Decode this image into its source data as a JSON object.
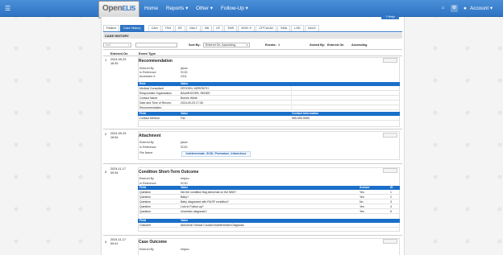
{
  "nav": {
    "menu_icon": "menu-icon",
    "logo_main": "Open",
    "logo_alt": "ELIS",
    "logo_sub": "Open Enterprise Laboratory Information System",
    "items": [
      "Home",
      "Reports ▾",
      "Other ▾",
      "Follow-Up ▾"
    ],
    "account": "Account ▾",
    "colors": {
      "bar": "#2f74c4",
      "accent": "#1a6fc9"
    }
  },
  "help_label": "? Help",
  "tabs": [
    "Patient",
    "Case History",
    "CAH",
    "TSH",
    "BT",
    "GALT",
    "HB",
    "CF",
    "TMS",
    "SCID ✔",
    "CPT1A AV",
    "SMA",
    "LSD",
    "XALD"
  ],
  "section_title": "CASE HISTORY",
  "controls": {
    "add_placeholder": "Add",
    "sort_by_label": "Sort By:",
    "sort_by_value": "Entered On, Ascending",
    "events_label": "Events:",
    "events_value": "4",
    "sorted_by_label": "Sorted By:",
    "sorted_by_field": "Entered On",
    "sorted_by_dir": "Ascending"
  },
  "columns": [
    "Entered On",
    "Event Type"
  ],
  "events": [
    {
      "num": "1",
      "date": "2024-09-23",
      "time": "16:39",
      "title": "Recommendation",
      "fields": [
        [
          "Entered By",
          "jlauer"
        ],
        [
          "In Reference",
          "SCID"
        ],
        [
          "Accession #",
          "2311"
        ]
      ],
      "role_header": [
        "Role",
        "Value"
      ],
      "roles": [
        [
          "Medical Consultant",
          "DRYDEN, MEREDITH"
        ],
        [
          "Responsible Organization",
          "BAUMHOVER, RENEE"
        ],
        [
          "Contact Name",
          "Bonnie White"
        ],
        [
          "Date and Time of Recom.",
          "2024-09-23 17:45"
        ],
        [
          "Recommendation",
          ""
        ]
      ],
      "contact_header": [
        "Field",
        "Value",
        "Contact Information"
      ],
      "contact": [
        "Contact Method",
        "Fax",
        "555-555-5555"
      ]
    },
    {
      "num": "2",
      "date": "2024-09-23",
      "time": "16:54",
      "title": "Attachment",
      "fields": [
        [
          "Entered By",
          "jlauer"
        ],
        [
          "In Reference",
          "SCID"
        ],
        [
          "File Name",
          ""
        ]
      ],
      "file": "Indeterminate_SCID_Premature_Infant.docx"
    },
    {
      "num": "3",
      "date": "2024-11-17",
      "time": "09:34",
      "title": "Condition Short-Term Outcome",
      "fields": [
        [
          "Entered By",
          "hirlyeu"
        ],
        [
          "In Reference",
          "SCID"
        ]
      ],
      "q_header": [
        "Field",
        "Value",
        "Answer",
        "ID"
      ],
      "questions": [
        [
          "Question",
          "Did the condition flag abnormal on the NBS?",
          "Yes",
          "1"
        ],
        [
          "Question",
          "Baby?",
          "Yes",
          "2"
        ],
        [
          "Question",
          "Baby diagnosed with RUSP condition?",
          "No",
          "3"
        ],
        [
          "Question",
          "Lost to Follow-up?",
          "Yes",
          "4"
        ],
        [
          "Question",
          "Uncertain diagnosis?",
          "Yes",
          "5"
        ]
      ],
      "outcome_header": [
        "Field",
        "Value"
      ],
      "outcome": [
        "Outcome",
        "Abnormal Clinical Course/Undetermined Diagnosis"
      ]
    },
    {
      "num": "4",
      "date": "2024-11-17",
      "time": "09:41",
      "title": "Case Outcome",
      "fields": [
        [
          "Entered By",
          "hirlyeu"
        ]
      ]
    }
  ]
}
